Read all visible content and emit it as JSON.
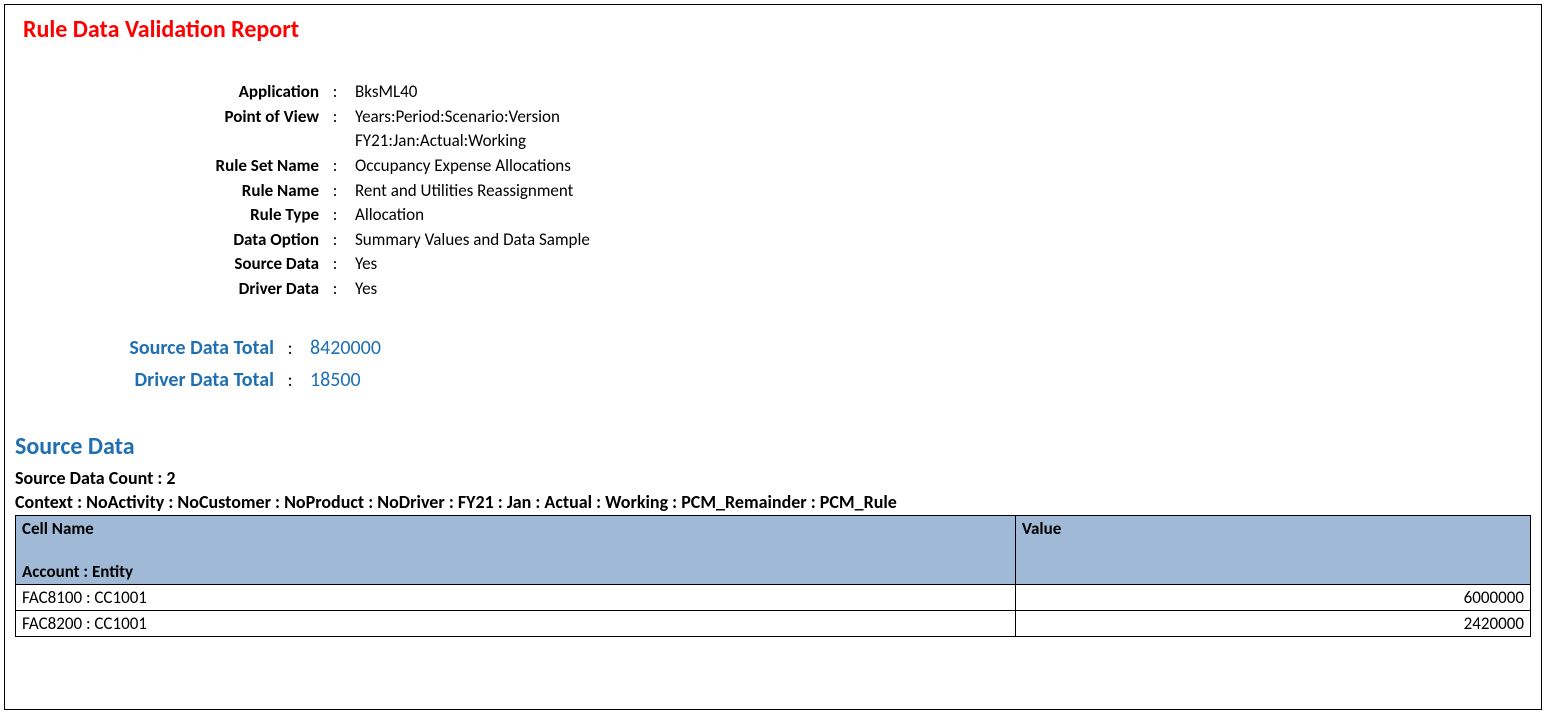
{
  "title": "Rule Data Validation Report",
  "meta": {
    "application": {
      "label": "Application",
      "value": "BksML40"
    },
    "pov": {
      "label": "Point of View",
      "value_line1": "Years:Period:Scenario:Version",
      "value_line2": "FY21:Jan:Actual:Working"
    },
    "rule_set_name": {
      "label": "Rule Set Name",
      "value": "Occupancy Expense Allocations"
    },
    "rule_name": {
      "label": "Rule Name",
      "value": "Rent and Utilities Reassignment"
    },
    "rule_type": {
      "label": "Rule Type",
      "value": "Allocation"
    },
    "data_option": {
      "label": "Data Option",
      "value": "Summary Values and Data Sample"
    },
    "source_data": {
      "label": "Source Data",
      "value": "Yes"
    },
    "driver_data": {
      "label": "Driver Data",
      "value": "Yes"
    }
  },
  "totals": {
    "source": {
      "label": "Source Data Total",
      "value": "8420000"
    },
    "driver": {
      "label": "Driver Data Total",
      "value": "18500"
    }
  },
  "source_section": {
    "title": "Source Data",
    "count_label": "Source Data Count : 2",
    "context": "Context : NoActivity : NoCustomer : NoProduct : NoDriver : FY21 : Jan : Actual : Working : PCM_Remainder : PCM_Rule",
    "headers": {
      "cell_name_main": "Cell Name",
      "cell_name_sub": "Account : Entity",
      "value": "Value"
    },
    "rows": [
      {
        "cell": "FAC8100 : CC1001",
        "value": "6000000"
      },
      {
        "cell": "FAC8200 : CC1001",
        "value": "2420000"
      }
    ]
  }
}
